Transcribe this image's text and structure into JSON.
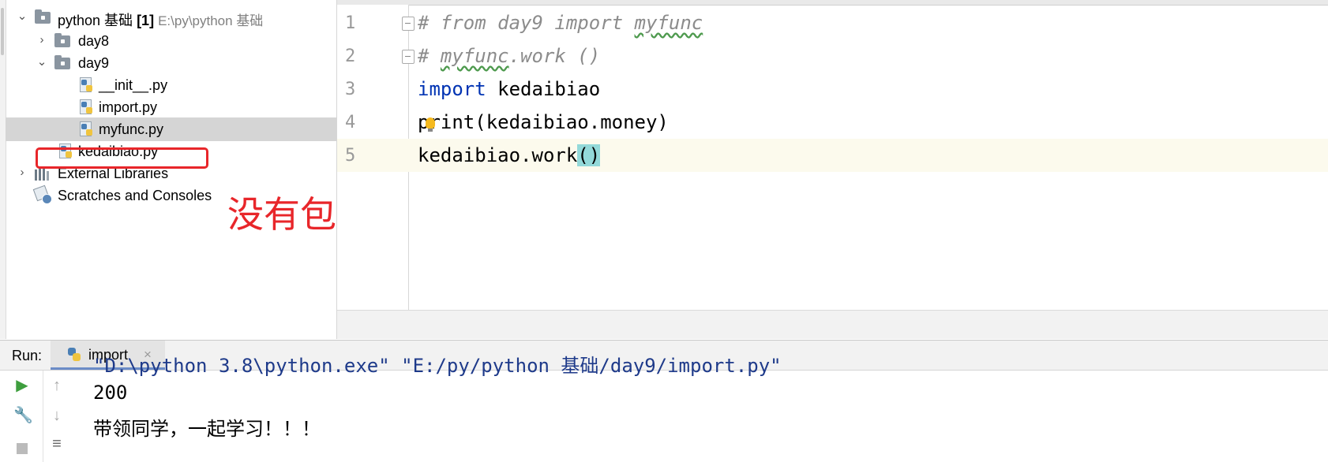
{
  "project_tree": {
    "root": {
      "name": "python 基础",
      "badge": "[1]",
      "path": "E:\\py\\python 基础"
    },
    "items": [
      {
        "label": "day8"
      },
      {
        "label": "day9"
      },
      {
        "label": "__init__.py"
      },
      {
        "label": "import.py"
      },
      {
        "label": "myfunc.py"
      },
      {
        "label": "kedaibiao.py"
      },
      {
        "label": "External Libraries"
      },
      {
        "label": "Scratches and Consoles"
      }
    ]
  },
  "annotation": {
    "text": "没有包",
    "color": "#e8262a"
  },
  "editor": {
    "lines": [
      {
        "number": "1",
        "text": "# from day9 import myfunc"
      },
      {
        "number": "2",
        "text": "# myfunc.work ()"
      },
      {
        "number": "3",
        "keyword": "import",
        "rest": " kedaibiao"
      },
      {
        "number": "4",
        "text": "print(kedaibiao.money)"
      },
      {
        "number": "5",
        "text_before": "kedaibiao.work",
        "text_paren": "()"
      }
    ],
    "current_line": 5
  },
  "run_panel": {
    "title": "Run:",
    "tab_label": "import",
    "tab_close": "×",
    "console": [
      "\"D:\\python 3.8\\python.exe\" \"E:/py/python 基础/day9/import.py\"",
      "200",
      "带领同学，一起学习！！！"
    ]
  },
  "colors": {
    "keyword": "#0033b3",
    "comment": "#8c8c8c",
    "console_path": "#1e3a8a",
    "selection": "#d5d5d5",
    "current_line": "#fcfaed",
    "bracket_match": "#93d9d9",
    "highlight_box": "#e8262a"
  },
  "icons": [
    "folder-icon",
    "python-file-icon",
    "libraries-icon",
    "scratches-icon",
    "run-icon",
    "wrench-icon",
    "stop-icon",
    "up-arrow-icon",
    "down-arrow-icon",
    "soft-wrap-icon",
    "lightbulb-icon"
  ]
}
